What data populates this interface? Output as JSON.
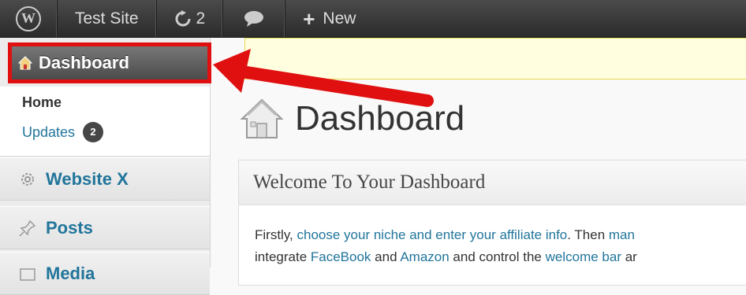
{
  "admin_bar": {
    "site_name": "Test Site",
    "updates_count": "2",
    "new_label": "New"
  },
  "sidebar": {
    "dashboard_label": "Dashboard",
    "submenu": {
      "home_label": "Home",
      "updates_label": "Updates",
      "updates_badge": "2"
    },
    "items": [
      {
        "label": "Website X",
        "icon": "gear-icon"
      },
      {
        "label": "Posts",
        "icon": "pin-icon"
      },
      {
        "label": "Media",
        "icon": "media-icon"
      }
    ]
  },
  "main": {
    "page_title": "Dashboard",
    "welcome_box": {
      "title": "Welcome To Your Dashboard",
      "line1": {
        "t1": "Firstly, ",
        "link1": "choose your niche and enter your affiliate info",
        "t2": ". Then ",
        "link2": "man"
      },
      "line2": {
        "t1": "integrate ",
        "link1": "FaceBook",
        "t2": " and ",
        "link2": "Amazon",
        "t3": " and control the ",
        "link3": "welcome bar",
        "t4": " ar"
      }
    }
  },
  "colors": {
    "highlight": "#e01010",
    "link": "#21759b",
    "admin_bar": "#333333"
  }
}
